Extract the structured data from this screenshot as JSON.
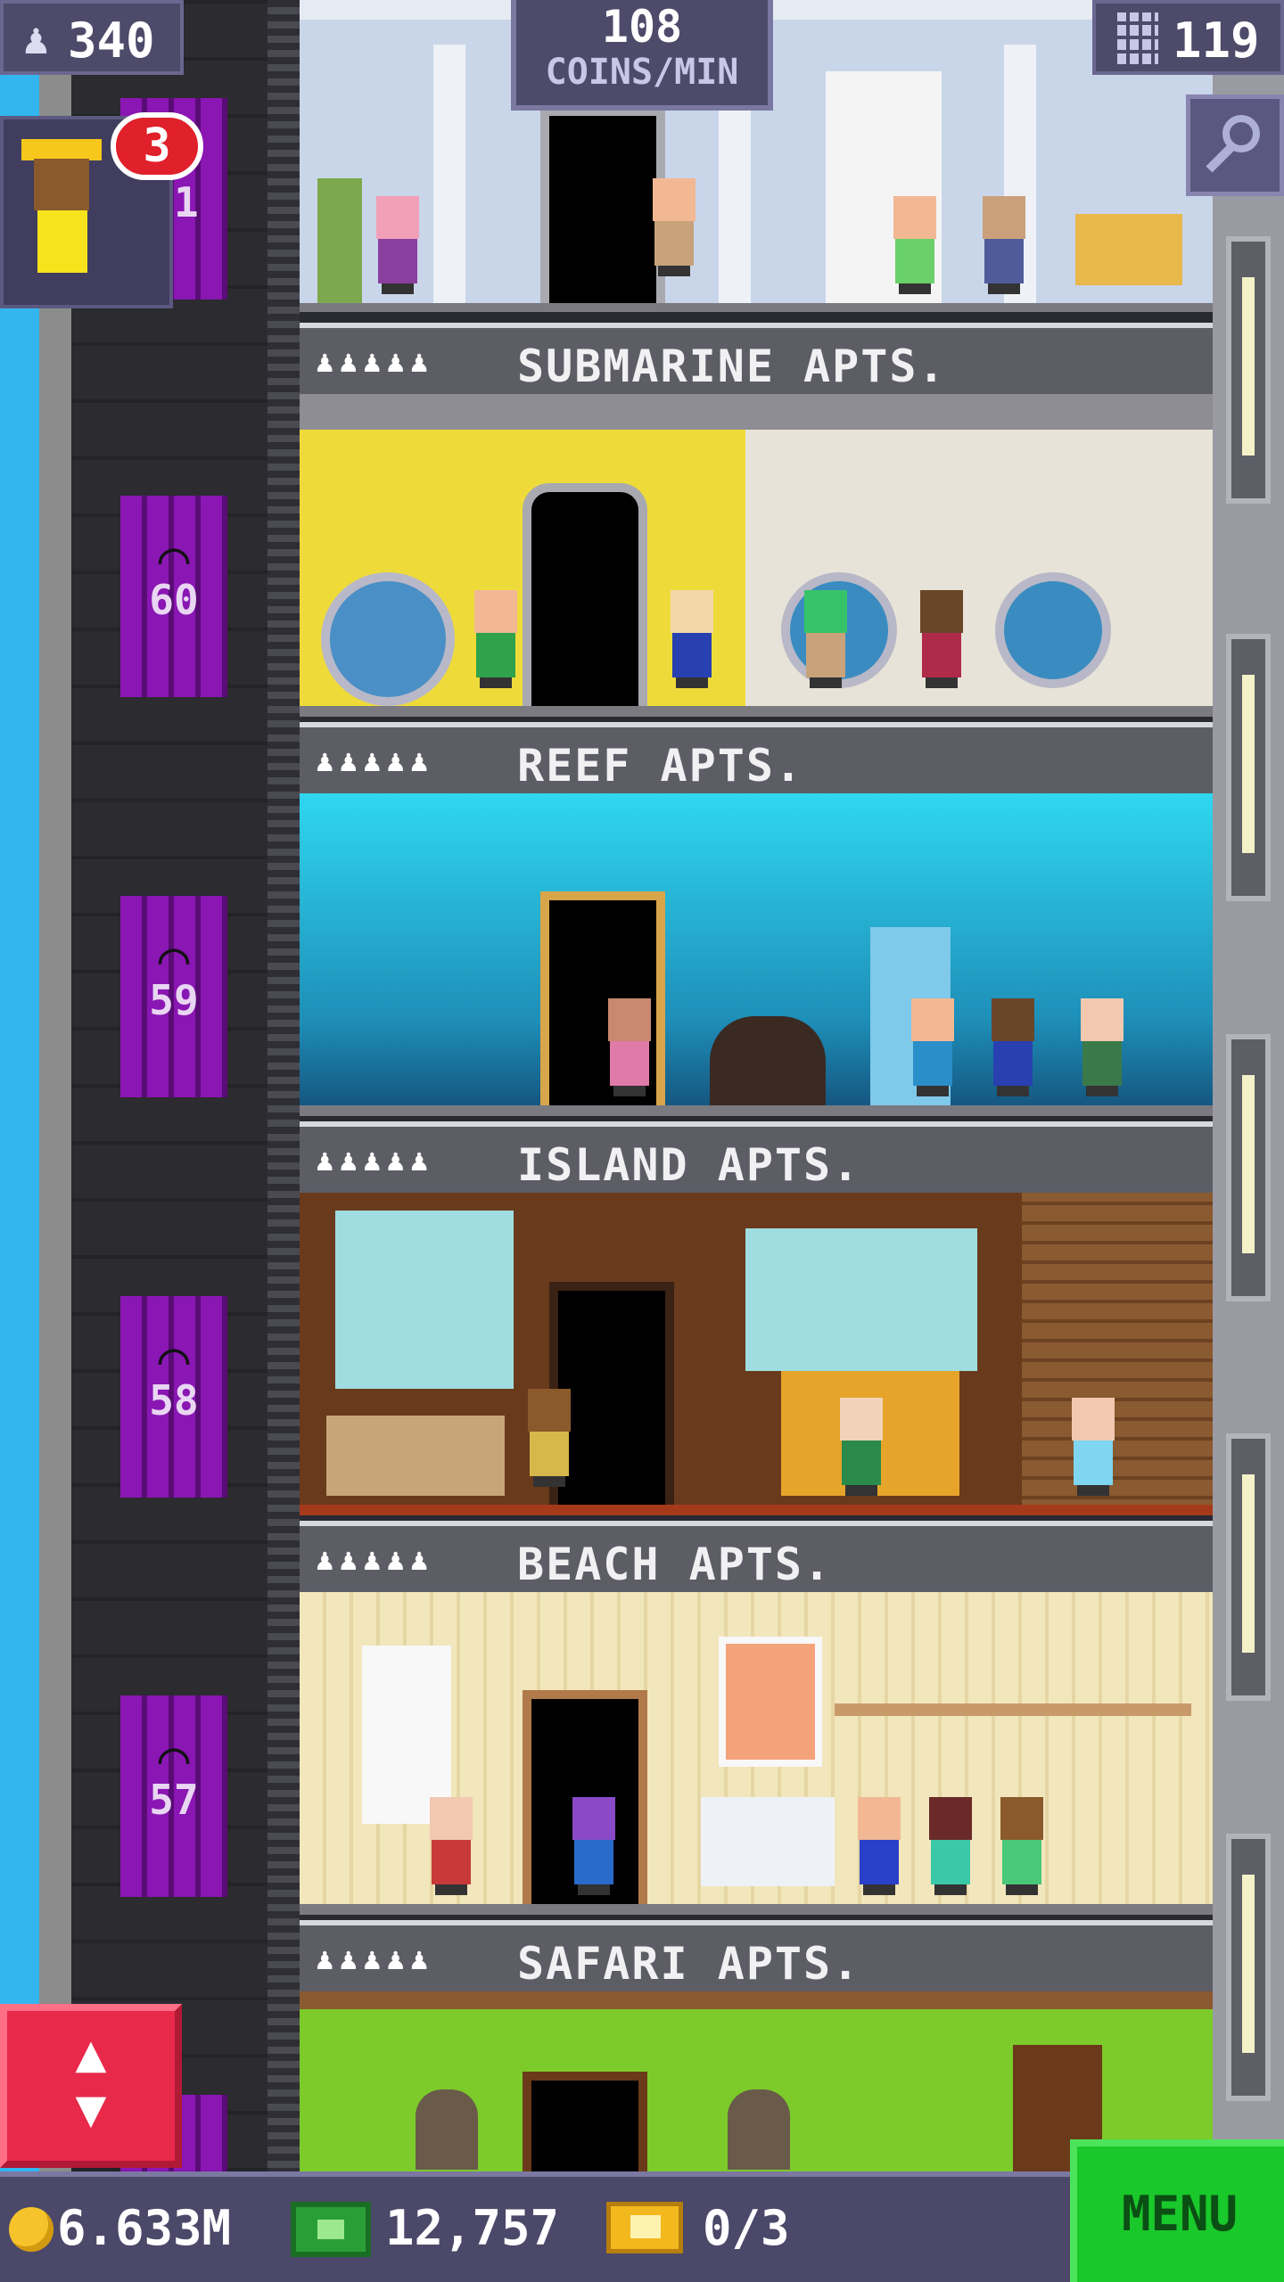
{
  "hud": {
    "population": "340",
    "coins_rate_value": "108",
    "coins_rate_label": "COINS/MIN",
    "floors": "119",
    "visitor_badge": "3"
  },
  "elevator": {
    "floor_numbers": [
      "61",
      "60",
      "59",
      "58",
      "57"
    ]
  },
  "floors": [
    {
      "name": "SUBMARINE APTS.",
      "people_icons": "♟♟♟♟♟"
    },
    {
      "name": "REEF APTS.",
      "people_icons": "♟♟♟♟♟"
    },
    {
      "name": "ISLAND APTS.",
      "people_icons": "♟♟♟♟♟"
    },
    {
      "name": "BEACH APTS.",
      "people_icons": "♟♟♟♟♟"
    },
    {
      "name": "SAFARI APTS.",
      "people_icons": "♟♟♟♟♟"
    }
  ],
  "bottom_bar": {
    "coins": "6.633M",
    "tower_bux": "12,757",
    "tickets": "0/3",
    "menu_label": "MENU"
  },
  "icons": {
    "population": "person-icon",
    "floors": "building-icon",
    "search": "magnifier-icon",
    "coin": "coin-icon",
    "bux": "bux-icon",
    "ticket": "ticket-icon",
    "elevator": "up-down-arrows-icon"
  },
  "colors": {
    "sky": "#33b6f0",
    "elevator_door": "#6f108f",
    "menu_button": "#19c82a",
    "elevator_button": "#e8294a",
    "hud_panel": "#4d4a6a"
  }
}
